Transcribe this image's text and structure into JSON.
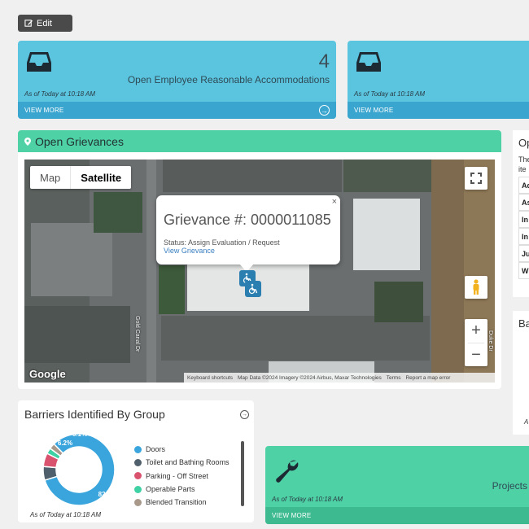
{
  "toolbar": {
    "edit_label": "Edit"
  },
  "tiles": [
    {
      "count": "4",
      "label": "Open Employee Reasonable Accommodations",
      "asof": "As of Today at 10:18 AM",
      "view_more": "VIEW MORE"
    },
    {
      "asof": "As of Today at 10:18 AM",
      "view_more": "VIEW MORE"
    }
  ],
  "projects_tile": {
    "label": "Projects",
    "asof": "As of Today at 10:18 AM",
    "view_more": "VIEW MORE"
  },
  "grievances": {
    "title": "Open Grievances",
    "map_type": {
      "map": "Map",
      "satellite": "Satellite"
    },
    "info": {
      "title": "Grievance #: 0000011085",
      "status": "Status: Assign Evaluation / Request",
      "link": "View Grievance",
      "close": "×"
    },
    "street": "Gold Canal Dr",
    "street2": "Duke Dr",
    "google": "Google",
    "attribution": [
      "Keyboard shortcuts",
      "Map Data ©2024 Imagery ©2024 Airbus, Maxar Technologies",
      "Terms",
      "Report a map error"
    ]
  },
  "side_panel": {
    "title": "Op",
    "text": [
      "The",
      "ite"
    ],
    "rows": [
      "Ad",
      "As",
      "In",
      "In",
      "Ju",
      "W"
    ]
  },
  "side_panel2": {
    "title": "Ba",
    "asof": "A"
  },
  "barriers": {
    "title": "Barriers Identified By Group",
    "asof": "As of Today at 10:18 AM",
    "legend": [
      {
        "label": "Doors",
        "color": "#3aa5dc"
      },
      {
        "label": "Toilet and Bathing Rooms",
        "color": "#4f5f6b"
      },
      {
        "label": "Parking - Off Street",
        "color": "#d9536f"
      },
      {
        "label": "Operable Parts",
        "color": "#3dd1a4"
      },
      {
        "label": "Blended Transition",
        "color": "#a8998b"
      }
    ],
    "donut_labels": {
      "big": "82.5%",
      "mid": "6.2%",
      "small": "6.1%"
    }
  },
  "chart_data": {
    "type": "pie",
    "title": "Barriers Identified By Group",
    "categories": [
      "Doors",
      "Toilet and Bathing Rooms",
      "Parking - Off Street",
      "Operable Parts",
      "Blended Transition"
    ],
    "values": [
      82.5,
      6.2,
      6.1,
      2.6,
      2.6
    ],
    "legend": "right"
  }
}
